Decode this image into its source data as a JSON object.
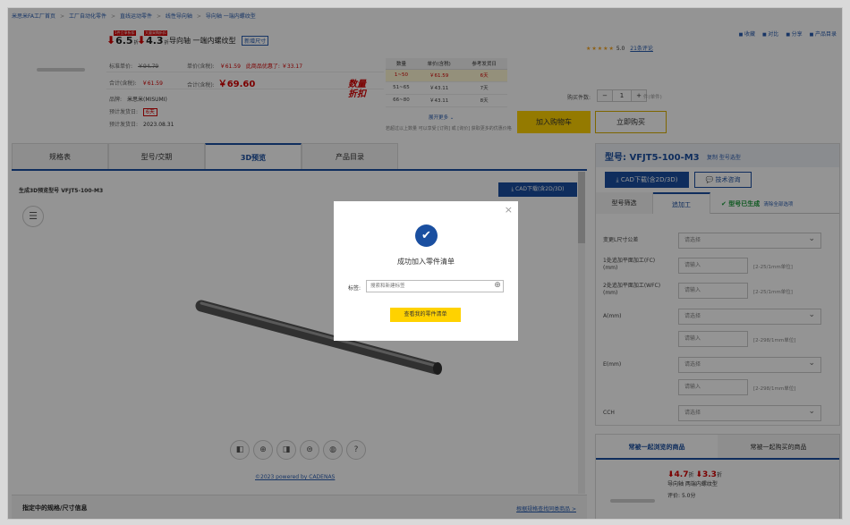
{
  "breadcrumb": [
    "米思米FA工厂首页",
    "工厂自动化零件",
    "直线运动零件",
    "线性导向轴",
    "导向轴 一端内螺纹型"
  ],
  "product": {
    "discount1": "6.5",
    "discount1_tag": "1件立享折扣",
    "discount2": "4.3",
    "discount2_tag": "大量采购折扣",
    "off_text": "折",
    "title": "导向轴 一端内螺纹型",
    "title_badge": "新增尺寸",
    "std_price_label": "标准单价:",
    "std_price": "￥94.79",
    "unit_price_label": "单价(含税):",
    "unit_price": "￥61.59",
    "promo_text": "此商品优惠了: ￥33.17",
    "total_label": "合计(含税):",
    "total": "￥61.59",
    "total2_label": "合计(含税):",
    "total2": "￥69.60",
    "brand_label": "品牌:",
    "brand": "米思米(MISUMI)",
    "ship_label": "预计发货日:",
    "ship": "6天",
    "expire_label": "预计发货日:",
    "expire": "2023.08.31"
  },
  "stamp": {
    "line1": "数量",
    "line2": "折扣"
  },
  "volume_table": {
    "headers": [
      "数量",
      "单价(含税)",
      "参考发货日"
    ],
    "rows": [
      [
        "1~50",
        "￥61.59",
        "6天"
      ],
      [
        "51~65",
        "￥43.11",
        "7天"
      ],
      [
        "66~80",
        "￥43.11",
        "8天"
      ]
    ],
    "more": "展开更多 ⌄",
    "note": "若超过以上数量 可以享受 [订购] 或 [询价] 获取更多的优惠价格"
  },
  "top_actions": [
    "收藏",
    "对比",
    "分享",
    "产品目录"
  ],
  "rating": {
    "stars": "★★★★★",
    "score": "5.0",
    "link": "21条评论"
  },
  "order": {
    "qty_label": "购买件数:",
    "qty": "1",
    "minus": "−",
    "plus": "+",
    "qty_hint": "件(单件)",
    "cart": "加入购物车",
    "buy": "立即购买"
  },
  "tabs": [
    "规格表",
    "型号/交期",
    "3D预览",
    "产品目录"
  ],
  "viewer": {
    "title": "生成3D预览型号 VFJT5-100-M3",
    "cad_btn": "CAD下载(含2D/3D)",
    "menu_icon": "☰",
    "view_icons": [
      "◧",
      "⊕",
      "◨",
      "⊜",
      "◍",
      "?"
    ],
    "powered": "©2023 powered by CADENAS"
  },
  "bottom": {
    "left": "指定中的规格/尺寸信息",
    "right": "根据规格查找同类商品 >"
  },
  "right_panel": {
    "model": "型号: VFJT5-100-M3",
    "links": "复制  型号选型",
    "cad": "CAD下载(含2D/3D)",
    "tech": "技术咨询",
    "tabs": [
      "型号筛选",
      "追加工"
    ],
    "status": "✔ 型号已生成",
    "clear": "清除全部选项",
    "rows": [
      {
        "label": "变更L尺寸公差",
        "placeholder": "请选择",
        "type": "select"
      },
      {
        "label": "1处追加平面加工(FC)\n(mm)",
        "placeholder": "请输入",
        "type": "input",
        "range": "[2-25/1mm单位]"
      },
      {
        "label": "2处追加平面加工(WFC)\n(mm)",
        "placeholder": "请输入",
        "type": "input",
        "range": "[2-25/1mm单位]"
      },
      {
        "label": "A(mm)",
        "placeholder": "请选择",
        "type": "select"
      },
      {
        "label": "",
        "placeholder": "请输入",
        "type": "input",
        "range": "[2-298/1mm单位]"
      },
      {
        "label": "E(mm)",
        "placeholder": "请选择",
        "type": "select"
      },
      {
        "label": "",
        "placeholder": "请输入",
        "type": "input",
        "range": "[2-298/1mm单位]"
      },
      {
        "label": "CCH",
        "placeholder": "请选择",
        "type": "select"
      }
    ]
  },
  "recommend": {
    "tabs": [
      "常被一起浏览的商品",
      "常被一起购买的商品"
    ],
    "d1": "4.7",
    "d2": "3.3",
    "off": "折",
    "name": "导向轴 两端内螺纹型",
    "rating_label": "评价:",
    "rating": "5.0分"
  },
  "modal": {
    "close": "×",
    "check": "✔",
    "message": "成功加入零件清单",
    "label": "标签:",
    "placeholder": "搜索和新建标签",
    "plus": "⊕",
    "button": "查看我的零件清单"
  }
}
